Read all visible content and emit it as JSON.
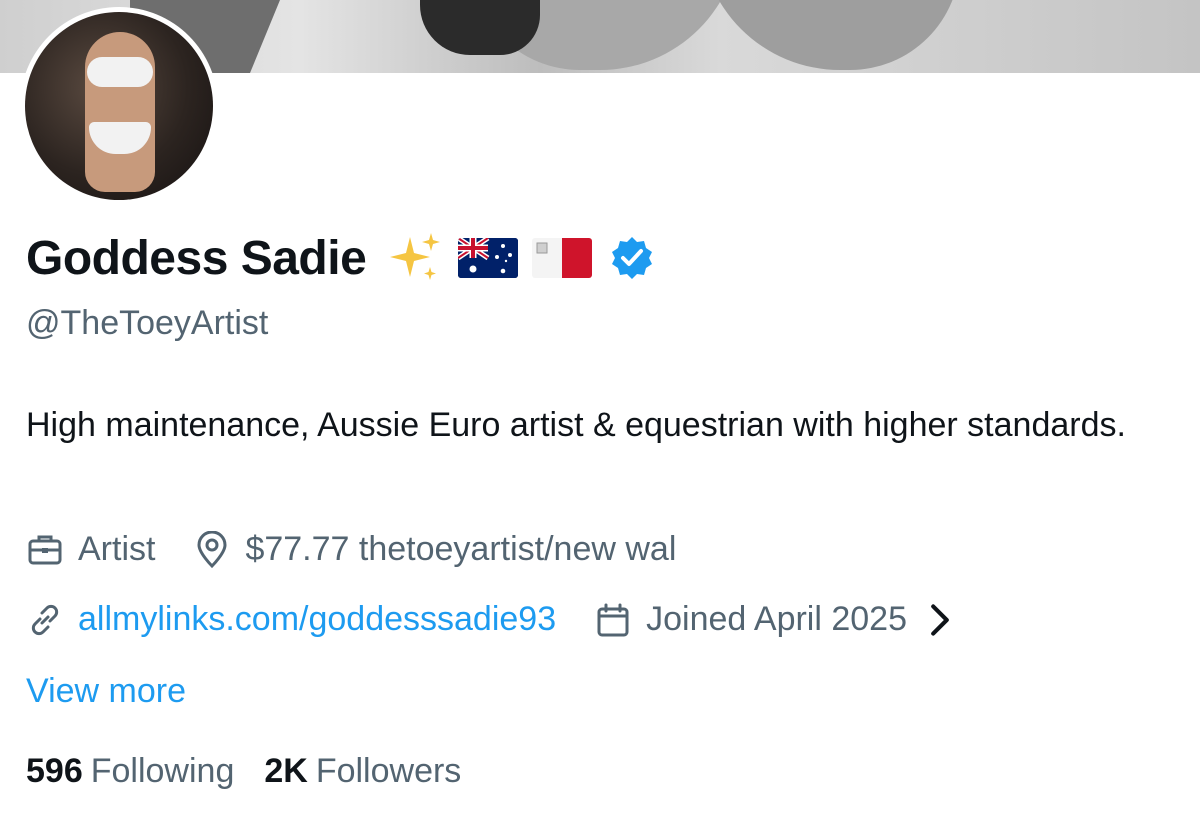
{
  "profile": {
    "display_name": "Goddess Sadie",
    "handle": "@TheToeyArtist",
    "name_emojis": [
      "sparkles-emoji",
      "australia-flag",
      "malta-flag"
    ],
    "verified": true,
    "bio": "High maintenance, Aussie Euro artist & equestrian with higher standards.",
    "profession": "Artist",
    "location": "$77.77 thetoeyartist/new wal",
    "website": "allmylinks.com/goddesssadie93",
    "joined": "Joined April 2025",
    "view_more": "View more",
    "following_count": "596",
    "following_label": "Following",
    "followers_count": "2K",
    "followers_label": "Followers"
  },
  "colors": {
    "accent": "#1d9bf0",
    "secondary_text": "#536471",
    "primary_text": "#0f1419"
  },
  "icons": {
    "profession": "briefcase-icon",
    "location": "location-pin-icon",
    "website": "link-icon",
    "joined": "calendar-icon",
    "expand": "chevron-right-icon",
    "verified": "verified-badge-icon"
  }
}
